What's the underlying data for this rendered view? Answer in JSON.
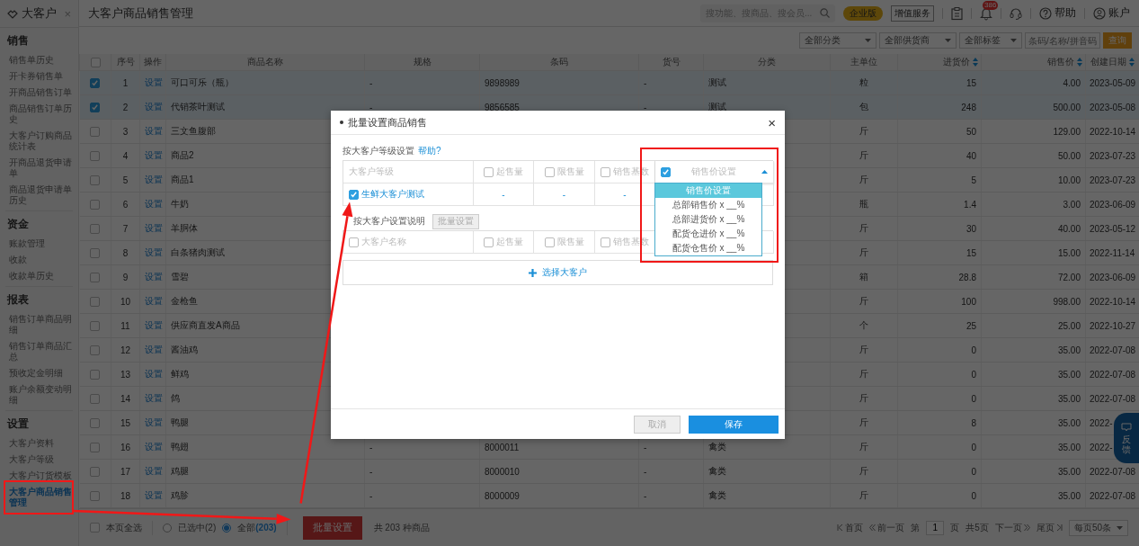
{
  "sidebar": {
    "title": "大客户",
    "close": "×",
    "sections": [
      {
        "heading": "销售",
        "items": [
          {
            "label": "销售单历史",
            "selected": false
          },
          {
            "label": "开卡券销售单",
            "selected": false
          },
          {
            "label": "开商品销售订单",
            "selected": false
          },
          {
            "label": "商品销售订单历史",
            "selected": false
          },
          {
            "label": "大客户订购商品统计表",
            "selected": false
          },
          {
            "label": "开商品退货申请单",
            "selected": false
          },
          {
            "label": "商品退货申请单历史",
            "selected": false
          }
        ]
      },
      {
        "heading": "资金",
        "items": [
          {
            "label": "账款管理",
            "selected": false
          },
          {
            "label": "收款",
            "selected": false
          },
          {
            "label": "收款单历史",
            "selected": false
          }
        ]
      },
      {
        "heading": "报表",
        "items": [
          {
            "label": "销售订单商品明细",
            "selected": false
          },
          {
            "label": "销售订单商品汇总",
            "selected": false
          },
          {
            "label": "预收定金明细",
            "selected": false
          },
          {
            "label": "账户余额变动明细",
            "selected": false
          }
        ]
      },
      {
        "heading": "设置",
        "items": [
          {
            "label": "大客户资料",
            "selected": false
          },
          {
            "label": "大客户等级",
            "selected": false
          },
          {
            "label": "大客户订货模板",
            "selected": false
          },
          {
            "label": "大客户商品销售管理",
            "selected": true
          }
        ]
      }
    ]
  },
  "header": {
    "page_title": "大客户商品销售管理",
    "search": {
      "placeholder": "搜功能、搜商品、搜会员..."
    },
    "edition_badge": "企业版",
    "service_button": "增值服务",
    "notification_count": "386",
    "help": "帮助",
    "account": "账户"
  },
  "filters": {
    "dropdowns": [
      "全部分类",
      "全部供货商",
      "全部标签"
    ],
    "search": {
      "placeholder": "条码/名称/拼音码"
    },
    "query_button": "查询"
  },
  "table": {
    "select_all": {
      "checked": false
    },
    "columns": [
      {
        "label": "序号",
        "sortable": false
      },
      {
        "label": "操作",
        "sortable": false
      },
      {
        "label": "商品名称",
        "sortable": false
      },
      {
        "label": "规格",
        "sortable": false
      },
      {
        "label": "条码",
        "sortable": false
      },
      {
        "label": "货号",
        "sortable": false
      },
      {
        "label": "分类",
        "sortable": false
      },
      {
        "label": "主单位",
        "sortable": false
      },
      {
        "label": "进货价",
        "sortable": true
      },
      {
        "label": "销售价",
        "sortable": true
      },
      {
        "label": "创建日期",
        "sortable": true
      }
    ],
    "rows": [
      {
        "index": "1",
        "action": "设置",
        "name": "可口可乐（瓶）",
        "spec": "-",
        "barcode": "9898989",
        "item_no": "-",
        "category": "测试",
        "unit": "粒",
        "cost": "15",
        "price": "4.00",
        "date": "2023-05-09",
        "checked": true
      },
      {
        "index": "2",
        "action": "设置",
        "name": "代销茶叶测试",
        "spec": "-",
        "barcode": "9856585",
        "item_no": "-",
        "category": "测试",
        "unit": "包",
        "cost": "248",
        "price": "500.00",
        "date": "2023-05-08",
        "checked": true
      },
      {
        "index": "3",
        "action": "设置",
        "name": "三文鱼腹部",
        "unit": "斤",
        "cost": "50",
        "price": "129.00",
        "date": "2022-10-14",
        "checked": false
      },
      {
        "index": "4",
        "action": "设置",
        "name": "商品2",
        "unit": "斤",
        "cost": "40",
        "price": "50.00",
        "date": "2023-07-23",
        "checked": false
      },
      {
        "index": "5",
        "action": "设置",
        "name": "商品1",
        "unit": "斤",
        "cost": "5",
        "price": "10.00",
        "date": "2023-07-23",
        "checked": false
      },
      {
        "index": "6",
        "action": "设置",
        "name": "牛奶",
        "unit": "瓶",
        "cost": "1.4",
        "price": "3.00",
        "date": "2023-06-09",
        "checked": false
      },
      {
        "index": "7",
        "action": "设置",
        "name": "羊胴体",
        "unit": "斤",
        "cost": "30",
        "price": "40.00",
        "date": "2023-05-12",
        "checked": false
      },
      {
        "index": "8",
        "action": "设置",
        "name": "白条猪肉测试",
        "unit": "斤",
        "cost": "15",
        "price": "15.00",
        "date": "2022-11-14",
        "checked": false
      },
      {
        "index": "9",
        "action": "设置",
        "name": "雪碧",
        "unit": "箱",
        "cost": "28.8",
        "price": "72.00",
        "date": "2023-06-09",
        "checked": false
      },
      {
        "index": "10",
        "action": "设置",
        "name": "金枪鱼",
        "unit": "斤",
        "cost": "100",
        "price": "998.00",
        "date": "2022-10-14",
        "checked": false
      },
      {
        "index": "11",
        "action": "设置",
        "name": "供应商直发A商品",
        "unit": "个",
        "cost": "25",
        "price": "25.00",
        "date": "2022-10-27",
        "checked": false
      },
      {
        "index": "12",
        "action": "设置",
        "name": "酱油鸡",
        "unit": "斤",
        "cost": "0",
        "price": "35.00",
        "date": "2022-07-08",
        "checked": false
      },
      {
        "index": "13",
        "action": "设置",
        "name": "鲜鸡",
        "unit": "斤",
        "cost": "0",
        "price": "35.00",
        "date": "2022-07-08",
        "checked": false
      },
      {
        "index": "14",
        "action": "设置",
        "name": "鸽",
        "unit": "斤",
        "cost": "0",
        "price": "35.00",
        "date": "2022-07-08",
        "checked": false
      },
      {
        "index": "15",
        "action": "设置",
        "name": "鸭腿",
        "unit": "斤",
        "cost": "8",
        "price": "35.00",
        "date": "2022-",
        "checked": false
      },
      {
        "index": "16",
        "action": "设置",
        "name": "鸭翅",
        "spec": "-",
        "barcode": "8000011",
        "item_no": "-",
        "category": "禽类",
        "unit": "斤",
        "cost": "0",
        "price": "35.00",
        "date": "2022-",
        "checked": false
      },
      {
        "index": "17",
        "action": "设置",
        "name": "鸡腿",
        "spec": "-",
        "barcode": "8000010",
        "item_no": "-",
        "category": "禽类",
        "unit": "斤",
        "cost": "0",
        "price": "35.00",
        "date": "2022-07-08",
        "checked": false
      },
      {
        "index": "18",
        "action": "设置",
        "name": "鸡胗",
        "spec": "-",
        "barcode": "8000009",
        "item_no": "-",
        "category": "禽类",
        "unit": "斤",
        "cost": "0",
        "price": "35.00",
        "date": "2022-07-08",
        "checked": false
      }
    ]
  },
  "footer": {
    "select_page": {
      "label": "本页全选",
      "checked": false
    },
    "scope": [
      {
        "label": "已选中",
        "count": "(2)",
        "selected": false
      },
      {
        "label": "全部",
        "count": "(203)",
        "selected": true
      }
    ],
    "batch_button": "批量设置",
    "total": "共 203 种商品",
    "pagination": {
      "first": "首页",
      "prev": "前一页",
      "page_prefix": "第",
      "page": "1",
      "page_suffix": "页",
      "total_pages": "共5页",
      "next": "下一页",
      "last": "尾页",
      "page_size": "每页50条"
    }
  },
  "feedback": "反馈",
  "modal": {
    "title": "批量设置商品销售",
    "close": "×",
    "level_section": {
      "label": "按大客户等级设置",
      "help_link": "帮助?",
      "columns": [
        {
          "label": "大客户等级",
          "kind": "text"
        },
        {
          "label": "起售量",
          "kind": "checkbox",
          "checked": false
        },
        {
          "label": "限售量",
          "kind": "checkbox",
          "checked": false
        },
        {
          "label": "销售基数",
          "kind": "checkbox",
          "checked": false
        },
        {
          "label": "销售价设置",
          "kind": "dropdown",
          "checked": true,
          "expanded": true
        }
      ],
      "rows": [
        {
          "checked": true,
          "cells": [
            "生鲜大客户测试",
            "-",
            "-",
            "-"
          ]
        }
      ]
    },
    "dropdown_options": [
      {
        "label": "销售价设置",
        "selected": true
      },
      {
        "label": "总部销售价 x __%",
        "selected": false
      },
      {
        "label": "总部进货价 x __%",
        "selected": false
      },
      {
        "label": "配货仓进价 x __%",
        "selected": false
      },
      {
        "label": "配货仓售价 x __%",
        "selected": false
      }
    ],
    "customer_section": {
      "label": "按大客户设置说明",
      "batch_button": {
        "label": "批量设置",
        "disabled": true
      },
      "columns": [
        {
          "label": "大客户名称",
          "checked": false
        },
        {
          "label": "起售量",
          "checked": false
        },
        {
          "label": "限售量",
          "checked": false
        },
        {
          "label": "销售基数",
          "checked": false
        }
      ],
      "add_button": "选择大客户"
    },
    "buttons": [
      {
        "label": "取消",
        "kind": "secondary",
        "disabled": true
      },
      {
        "label": "保存",
        "kind": "primary",
        "disabled": false
      }
    ]
  }
}
